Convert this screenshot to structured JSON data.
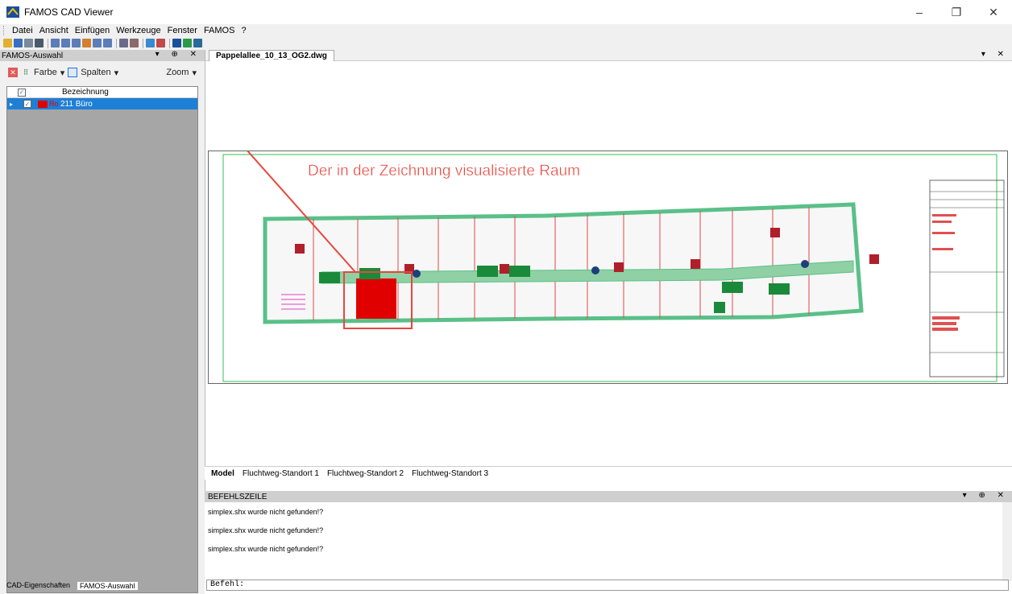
{
  "window": {
    "title": "FAMOS CAD  Viewer",
    "minimize": "–",
    "restore": "❐",
    "close": "✕"
  },
  "menu": [
    "Datei",
    "Ansicht",
    "Einfügen",
    "Werkzeuge",
    "Fenster",
    "FAMOS",
    "?"
  ],
  "left_panel": {
    "title": "FAMOS-Auswahl",
    "controls": "▾ ⊕ ✕",
    "filter": {
      "farbe_label": "Farbe",
      "spalten_label": "Spalten",
      "zoom_label": "Zoom"
    },
    "grid_header": "Bezeichnung",
    "rows": [
      {
        "code": "Ro",
        "label": "211 Büro"
      }
    ]
  },
  "doc": {
    "tab_label": "Pappelallee_10_13_OG2.dwg",
    "controls": "▾ ✕",
    "annotation": "Der in der Zeichnung visualisierte Raum"
  },
  "layout_tabs": [
    "Model",
    "Fluchtweg-Standort 1",
    "Fluchtweg-Standort 2",
    "Fluchtweg-Standort 3"
  ],
  "command": {
    "title": "BEFEHLSZEILE",
    "controls": "▾ ⊕ ✕",
    "lines": [
      "simplex.shx wurde nicht gefunden!?",
      "simplex.shx wurde nicht gefunden!?",
      "simplex.shx wurde nicht gefunden!?"
    ],
    "prompt": "Befehl:"
  },
  "bottom_tabs": [
    "CAD-Eigenschaften",
    "FAMOS-Auswahl"
  ],
  "colors": {
    "selection": "#1e7fd6",
    "annotation": "#e8463c",
    "room": "#e00000",
    "escape": "#1a8a3a"
  }
}
